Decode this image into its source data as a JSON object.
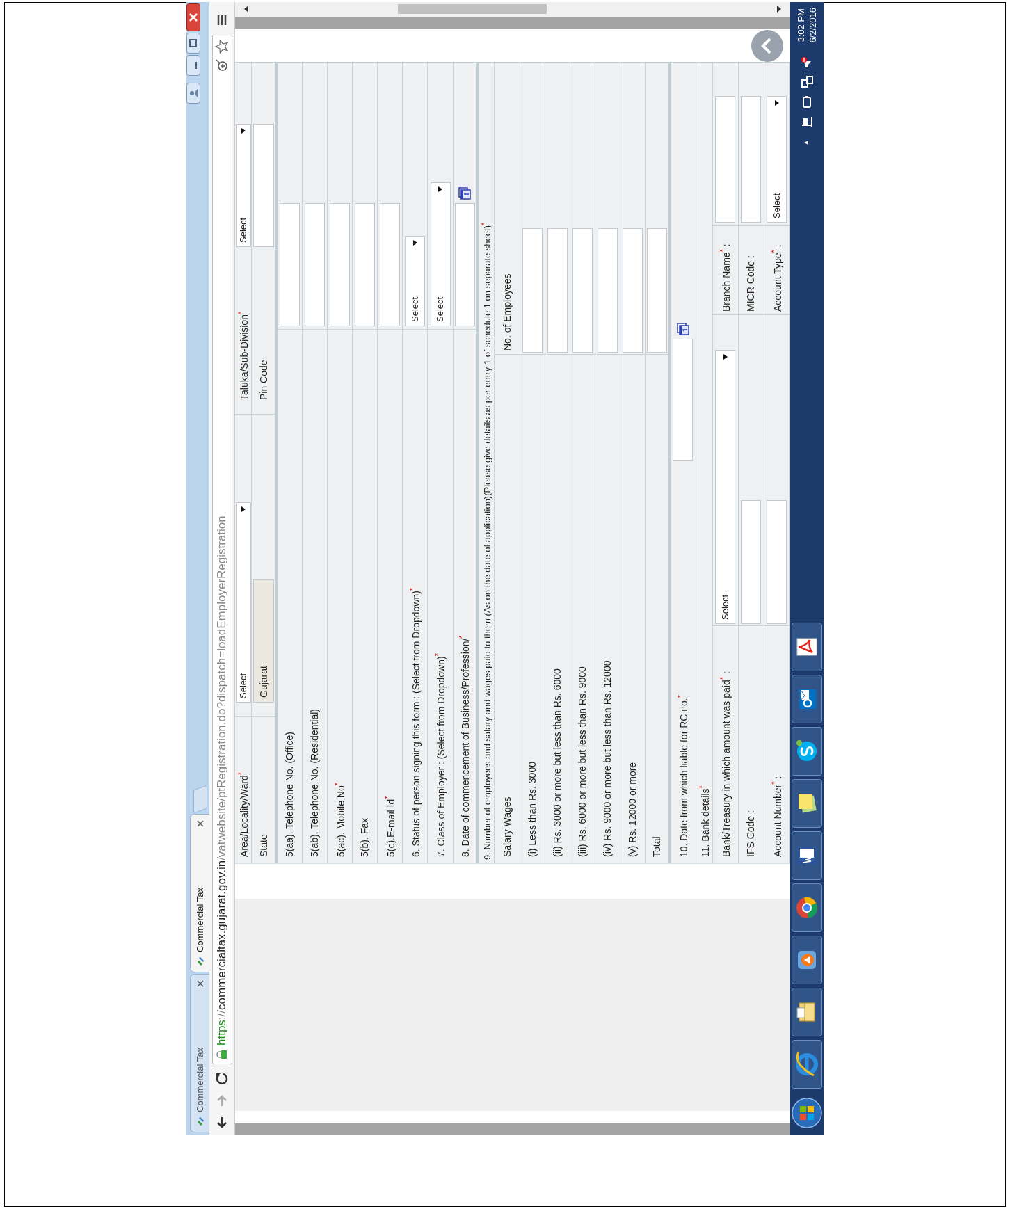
{
  "browser": {
    "tabs": [
      {
        "title": "Commercial Tax",
        "selected": false
      },
      {
        "title": "Commercial Tax",
        "selected": true
      }
    ],
    "url": {
      "scheme": "https",
      "separator": "://",
      "host": "commercialtax.gujarat.gov.in",
      "path": "/vatwebsite/ptRegistration.do?dispatch=loadEmployerRegistration"
    }
  },
  "form": {
    "location_rows": [
      {
        "label": "Area/Locality/Ward",
        "required_mark": "*",
        "field": {
          "kind": "select",
          "value": "Select"
        },
        "label_2": "Taluka/Sub-Division",
        "required_mark_2": "*",
        "field_2": {
          "kind": "select",
          "value": "Select"
        }
      },
      {
        "label": "State",
        "field": {
          "kind": "readonly",
          "value": "Gujarat"
        },
        "label_2": "Pin Code",
        "field_2": {
          "kind": "text"
        }
      }
    ],
    "contact_rows": [
      {
        "label": "5(aa). Telephone No. (Office)",
        "field": {
          "kind": "text"
        }
      },
      {
        "label": "5(ab). Telephone No. (Residential)",
        "field": {
          "kind": "text"
        }
      },
      {
        "label": "5(ac). Mobile No",
        "required_mark": "*",
        "field": {
          "kind": "text"
        }
      },
      {
        "label": "5(b). Fax",
        "field": {
          "kind": "text"
        }
      },
      {
        "label": "5(c).E-mail Id",
        "required_mark": "*",
        "field": {
          "kind": "text"
        }
      },
      {
        "label": "6. Status of person signing this form : (Select from Dropdown)",
        "required_mark": "*",
        "field": {
          "kind": "select",
          "value": "Select"
        }
      },
      {
        "label": "7. Class of Employer : (Select from Dropdown)",
        "required_mark": "*",
        "field": {
          "kind": "select",
          "value": "Select"
        }
      },
      {
        "label": "8. Date of commencement of Business/Profession/",
        "required_mark": "*",
        "field": {
          "kind": "date"
        }
      }
    ],
    "employees": {
      "heading": "9. Number of employees and salary and wages paid to them (As on the date of application)(Please give details as per entry 1 of schedule 1 on separate sheet)",
      "required_mark": "*",
      "column_1": "Salary Wages",
      "column_2": "No. of Employees",
      "rows": [
        "(i) Less than Rs. 3000",
        "(ii) Rs. 3000 or more but less than Rs. 6000",
        "(iii) Rs. 6000 or more but less than Rs. 9000",
        "(iv) Rs. 9000 or more but less than Rs. 12000",
        "(v) Rs. 12000 or more",
        "Total"
      ]
    },
    "liability_date": {
      "label": "10. Date from which liable for RC no.",
      "required_mark": "*"
    },
    "bank": {
      "heading": "11. Bank details",
      "required_mark": "*",
      "rows": [
        {
          "label": "Bank/Treasury in which amount was paid",
          "required_mark": "*",
          "suffix": ":",
          "field": {
            "kind": "select",
            "value": "Select"
          },
          "label_2": "Branch Name",
          "required_mark_2": "*",
          "suffix_2": ":",
          "field_2": {
            "kind": "text"
          }
        },
        {
          "label": "IFS Code",
          "suffix": ":",
          "field": {
            "kind": "text"
          },
          "label_2": "MICR Code",
          "suffix_2": ":",
          "field_2": {
            "kind": "text"
          }
        },
        {
          "label": "Account Number",
          "required_mark": "*",
          "suffix": ":",
          "field": {
            "kind": "text"
          },
          "label_2": "Account Type",
          "required_mark_2": "*",
          "suffix_2": ":",
          "field_2": {
            "kind": "select",
            "value": "Select"
          }
        }
      ]
    }
  },
  "taskbar": {
    "time": "3:02 PM",
    "date": "6/2/2016"
  }
}
